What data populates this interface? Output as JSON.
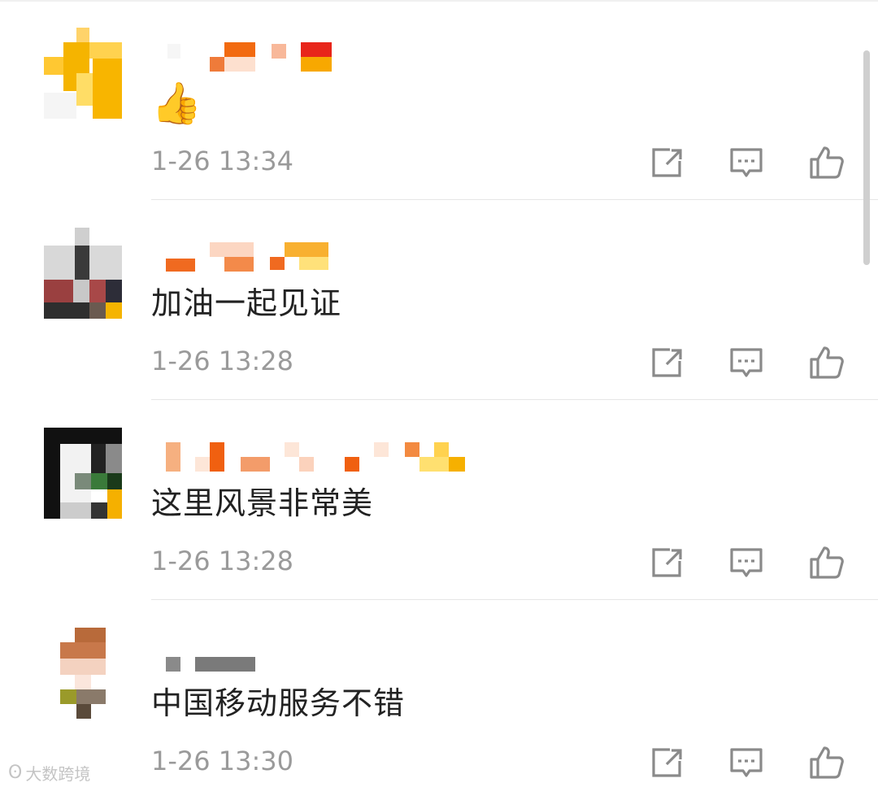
{
  "comments": [
    {
      "text": "👍",
      "time": "1-26 13:34"
    },
    {
      "text": "加油一起见证",
      "time": "1-26 13:28"
    },
    {
      "text": "这里风景非常美",
      "time": "1-26 13:28"
    },
    {
      "text": "中国移动服务不错",
      "time": "1-26 13:30"
    }
  ],
  "icons": {
    "share": "share-icon",
    "reply": "reply-icon",
    "like": "like-icon"
  },
  "watermark": {
    "text": "大数跨境"
  },
  "colors": {
    "text": "#222222",
    "time": "#9a9a9a",
    "icon": "#8a8a8a",
    "divider": "#e6e6e6"
  }
}
